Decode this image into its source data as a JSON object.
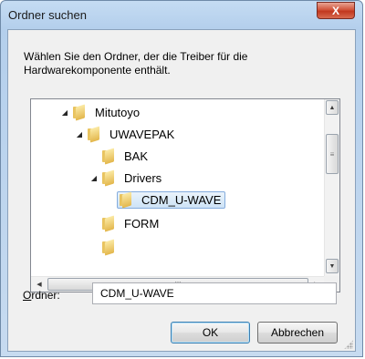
{
  "window": {
    "title": "Ordner suchen",
    "close_label": "X"
  },
  "dialog": {
    "description": "Wählen Sie den Ordner, der die Treiber für die Hardwarekomponente enthält."
  },
  "tree": {
    "items": [
      {
        "label": "Mitutoyo",
        "expander": "◢",
        "level": 2
      },
      {
        "label": "UWAVEPAK",
        "expander": "◢",
        "level": 3
      },
      {
        "label": "BAK",
        "expander": "",
        "level": 4
      },
      {
        "label": "Drivers",
        "expander": "◢",
        "level": 4
      },
      {
        "label": "CDM_U-WAVE",
        "expander": "",
        "level": 5,
        "selected": true
      },
      {
        "label": "FORM",
        "expander": "",
        "level": 4
      }
    ]
  },
  "scroll": {
    "up": "▲",
    "down": "▼",
    "left": "◀",
    "right": "▶",
    "grip": "≡",
    "hgrip": "III"
  },
  "folder_field": {
    "label_underlined": "O",
    "label_rest": "rdner:",
    "value": "CDM_U-WAVE"
  },
  "buttons": {
    "ok": "OK",
    "cancel": "Abbrechen"
  }
}
